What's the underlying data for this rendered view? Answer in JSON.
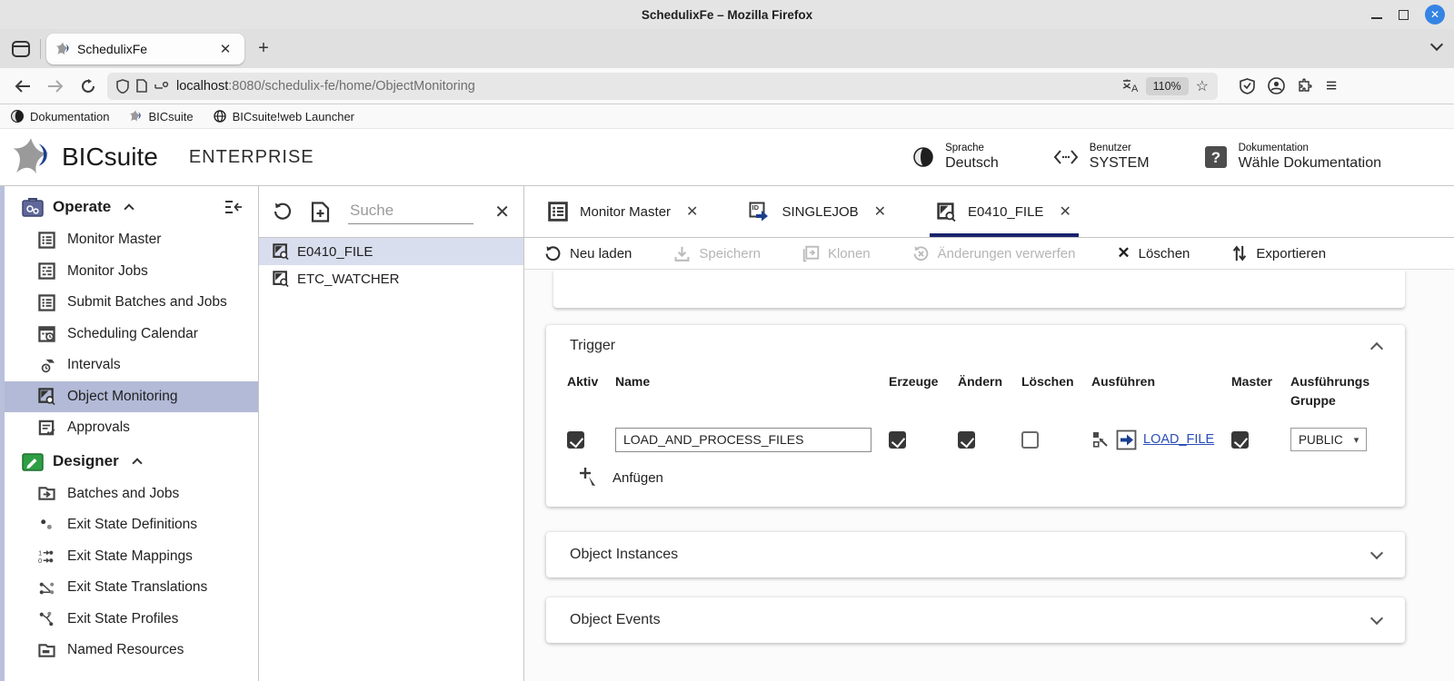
{
  "titlebar": {
    "title": "SchedulixFe – Mozilla Firefox"
  },
  "tabbar": {
    "tab_title": "SchedulixFe"
  },
  "navbar": {
    "url_host": "localhost",
    "url_rest": ":8080/schedulix-fe/home/ObjectMonitoring",
    "zoom_level": "110%"
  },
  "bookmarks": [
    {
      "label": "Dokumentation"
    },
    {
      "label": "BICsuite"
    },
    {
      "label": "BICsuite!web Launcher"
    }
  ],
  "app_header": {
    "brand": "BICsuite",
    "edition": "ENTERPRISE",
    "language": {
      "label": "Sprache",
      "value": "Deutsch"
    },
    "user": {
      "label": "Benutzer",
      "value": "SYSTEM"
    },
    "docs": {
      "label": "Dokumentation",
      "value": "Wähle Dokumentation"
    }
  },
  "sidebar": {
    "sections": [
      {
        "label": "Operate",
        "items": [
          "Monitor Master",
          "Monitor Jobs",
          "Submit Batches and Jobs",
          "Scheduling Calendar",
          "Intervals",
          "Object Monitoring",
          "Approvals"
        ]
      },
      {
        "label": "Designer",
        "items": [
          "Batches and Jobs",
          "Exit State Definitions",
          "Exit State Mappings",
          "Exit State Translations",
          "Exit State Profiles",
          "Named Resources"
        ]
      }
    ],
    "selected_item": "Object Monitoring"
  },
  "list_panel": {
    "search_placeholder": "Suche",
    "items": [
      "E0410_FILE",
      "ETC_WATCHER"
    ],
    "selected_item": "E0410_FILE"
  },
  "main": {
    "tabs": [
      {
        "label": "Monitor Master",
        "active": false
      },
      {
        "label": "SINGLEJOB",
        "active": false
      },
      {
        "label": "E0410_FILE",
        "active": true
      }
    ],
    "toolbar": [
      {
        "label": "Neu laden",
        "enabled": true
      },
      {
        "label": "Speichern",
        "enabled": false
      },
      {
        "label": "Klonen",
        "enabled": false
      },
      {
        "label": "Änderungen verwerfen",
        "enabled": false
      },
      {
        "label": "Löschen",
        "enabled": true
      },
      {
        "label": "Exportieren",
        "enabled": true
      }
    ],
    "trigger_section": {
      "title": "Trigger",
      "columns": [
        "Aktiv",
        "Name",
        "Erzeuge",
        "Ändern",
        "Löschen",
        "Ausführen",
        "Master",
        "Ausführungs Gruppe"
      ],
      "row": {
        "aktiv": true,
        "name": "LOAD_AND_PROCESS_FILES",
        "erzeuge": true,
        "aendern": true,
        "loeschen": false,
        "link": "LOAD_FILE",
        "master": true,
        "gruppe": "PUBLIC"
      },
      "add_label": "Anfügen"
    },
    "sections": [
      {
        "title": "Object Instances"
      },
      {
        "title": "Object Events"
      }
    ]
  },
  "icons": {
    "close": "✕",
    "plus": "+",
    "dropdown": "▾",
    "star": "☆",
    "hamburger": "≡"
  },
  "colors": {
    "accent_navy": "#19246b",
    "selected_sidebar": "#b3bad7",
    "selected_list": "#d9deee",
    "link_blue": "#2a4db8",
    "firefox_close": "#3584e4",
    "operate_icon": "#5f6899",
    "designer_icon": "#2f9e44"
  }
}
